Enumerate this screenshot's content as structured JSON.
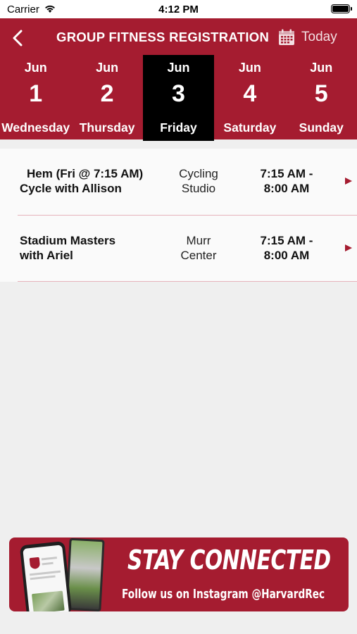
{
  "status_bar": {
    "carrier": "Carrier",
    "time": "4:12 PM",
    "icons": [
      "wifi-icon",
      "battery-icon"
    ]
  },
  "header": {
    "title": "GROUP FITNESS REGISTRATION",
    "back_icon": "chevron-left-icon",
    "calendar_icon": "calendar-icon",
    "today_label": "Today",
    "accent_color": "#a51c30"
  },
  "dates": [
    {
      "month": "Jun",
      "day": "1",
      "weekday": "Wednesday",
      "selected": false
    },
    {
      "month": "Jun",
      "day": "2",
      "weekday": "Thursday",
      "selected": false
    },
    {
      "month": "Jun",
      "day": "3",
      "weekday": "Friday",
      "selected": true
    },
    {
      "month": "Jun",
      "day": "4",
      "weekday": "Saturday",
      "selected": false
    },
    {
      "month": "Jun",
      "day": "5",
      "weekday": "Sunday",
      "selected": false
    }
  ],
  "classes": [
    {
      "name_line1": "Hem (Fri @ 7:15 AM)",
      "name_line2": "Cycle with Allison",
      "location_line1": "Cycling",
      "location_line2": "Studio",
      "time_line1": "7:15 AM -",
      "time_line2": "8:00 AM"
    },
    {
      "name_line1": "Stadium Masters",
      "name_line2": "with Ariel",
      "location_line1": "Murr",
      "location_line2": "Center",
      "time_line1": "7:15 AM -",
      "time_line2": "8:00 AM"
    }
  ],
  "banner": {
    "headline": "STAY CONNECTED",
    "subtext": "Follow us on Instagram @HarvardRec",
    "image": "instagram-phones-illustration"
  }
}
